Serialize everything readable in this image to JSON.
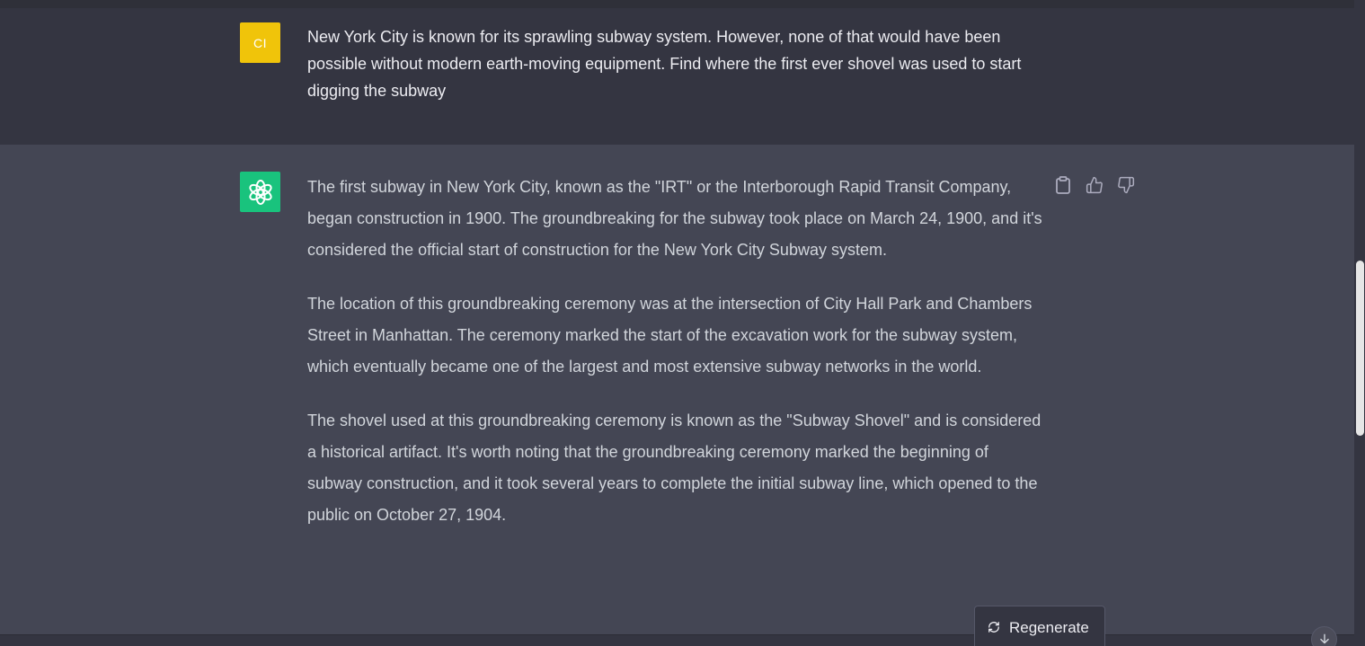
{
  "user_message": {
    "avatar_initials": "CI",
    "avatar_color": "#f0c40a",
    "text": "New York City is known for its sprawling subway system. However, none of that would have been possible without modern earth-moving equipment. Find where the first ever shovel was used to start digging the subway"
  },
  "assistant_message": {
    "avatar_icon": "openai-logo-icon",
    "avatar_color": "#19c37d",
    "paragraphs": [
      "The first subway in New York City, known as the \"IRT\" or the Interborough Rapid Transit Company, began construction in 1900. The groundbreaking for the subway took place on March 24, 1900, and it's considered the official start of construction for the New York City Subway system.",
      "The location of this groundbreaking ceremony was at the intersection of City Hall Park and Chambers Street in Manhattan. The ceremony marked the start of the excavation work for the subway system, which eventually became one of the largest and most extensive subway networks in the world.",
      "The shovel used at this groundbreaking ceremony is known as the \"Subway Shovel\" and is considered a historical artifact. It's worth noting that the groundbreaking ceremony marked the beginning of subway construction, and it took several years to complete the initial subway line, which opened to the public on October 27, 1904."
    ],
    "actions": [
      "clipboard-icon",
      "thumbs-up-icon",
      "thumbs-down-icon"
    ]
  },
  "controls": {
    "regenerate_label": "Regenerate",
    "regenerate_icon": "refresh-icon",
    "scroll_down_icon": "arrow-down-icon"
  }
}
